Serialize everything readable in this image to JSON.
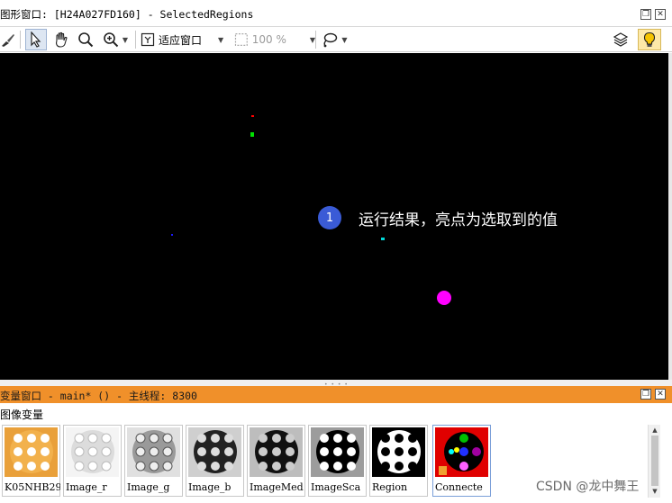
{
  "graphics_window": {
    "title": "图形窗口: [H24A027FD160] - SelectedRegions",
    "toolbar": {
      "fit_window_label": "适应窗口",
      "zoom_label": "100 %"
    }
  },
  "canvas": {
    "background": "#000000",
    "annotation": {
      "number": "1",
      "text": "运行结果，亮点为选取到的值"
    },
    "regions": [
      {
        "name": "red-point",
        "color": "#ff0000"
      },
      {
        "name": "green-point",
        "color": "#00e000"
      },
      {
        "name": "blue-point",
        "color": "#1a1aff"
      },
      {
        "name": "cyan-point",
        "color": "#00d8d8"
      },
      {
        "name": "magenta-blob",
        "color": "#ff00ff"
      }
    ]
  },
  "variable_window": {
    "title": "变量窗口 - main* () - 主线程: 8300",
    "section_label": "图像变量",
    "thumbnails": [
      {
        "label": "K05NHB29"
      },
      {
        "label": "Image_r"
      },
      {
        "label": "Image_g"
      },
      {
        "label": "Image_b"
      },
      {
        "label": "ImageMed"
      },
      {
        "label": "ImageSca"
      },
      {
        "label": "Region"
      },
      {
        "label": "Connecte"
      }
    ]
  },
  "watermark": "CSDN @龙中舞王"
}
